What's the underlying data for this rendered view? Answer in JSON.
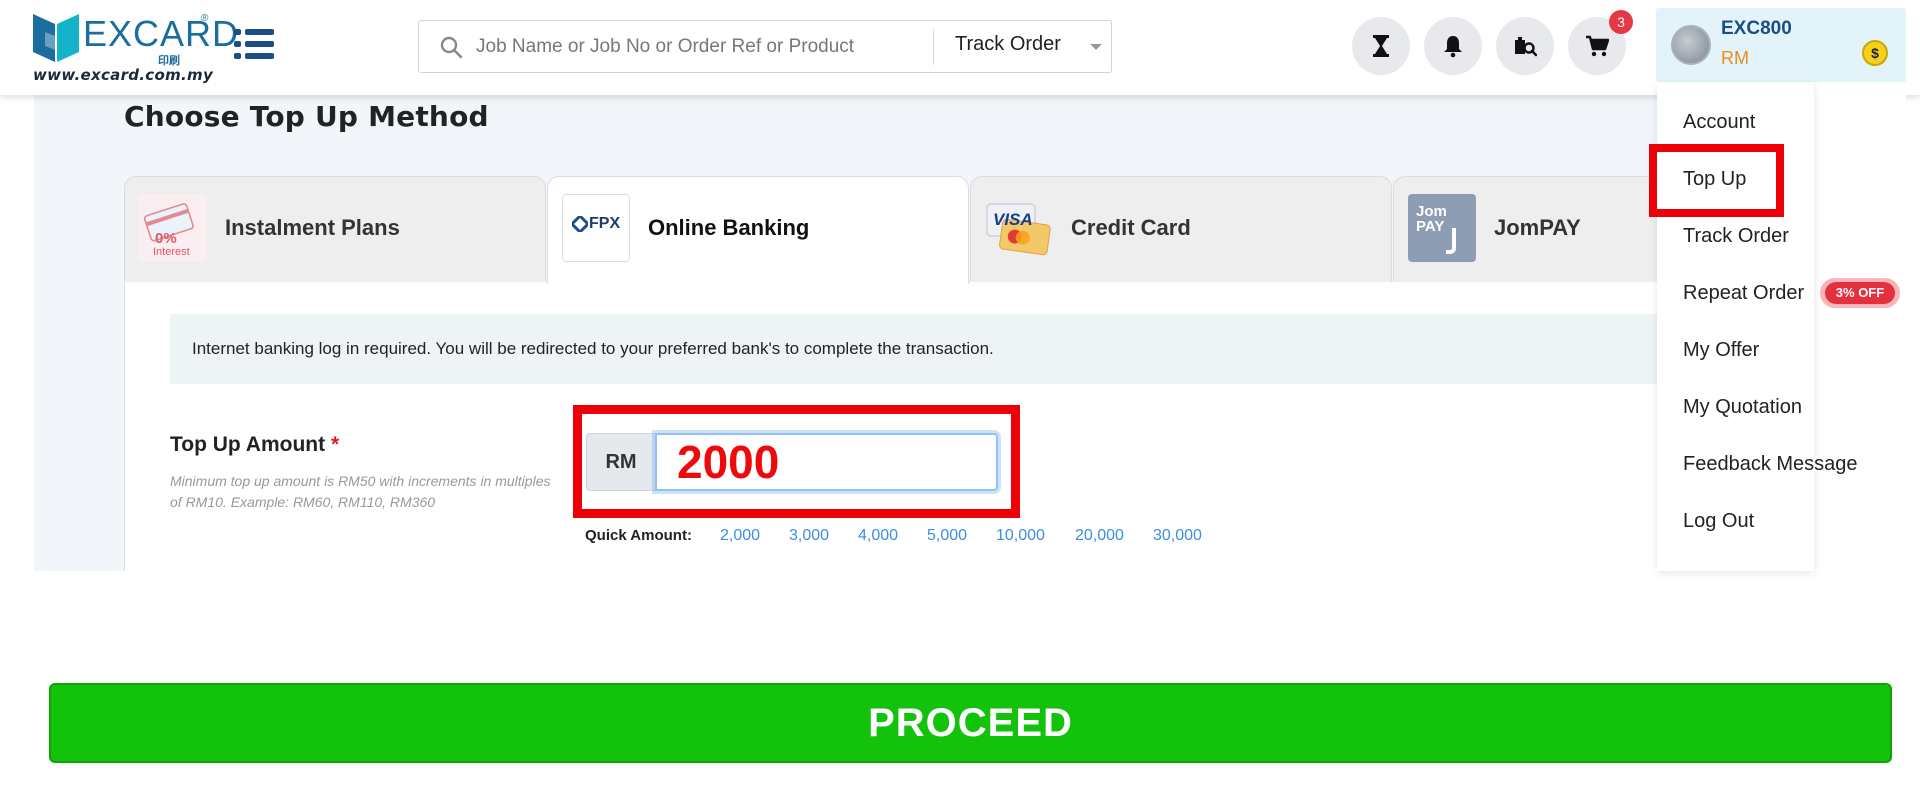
{
  "header": {
    "logo": {
      "word": "EXCARD",
      "reg": "®",
      "sub": "印刷",
      "url": "www.excard.com.my"
    },
    "search": {
      "placeholder": "Job Name or Job No or Order Ref or Product",
      "select_value": "Track Order"
    },
    "icons": [
      "hourglass-icon",
      "bell-icon",
      "job-search-icon",
      "cart-icon"
    ],
    "cart_count": "3",
    "user": {
      "name": "EXC800",
      "balance": "RM",
      "coin_symbol": "$"
    }
  },
  "main": {
    "heading": "Choose Top Up Method",
    "tabs": [
      {
        "label": "Instalment Plans",
        "icon": "instalment-card-icon",
        "icon_text": "0%",
        "icon_sub": "Interest"
      },
      {
        "label": "Online Banking",
        "icon": "fpx-icon",
        "icon_text": "FPX",
        "active": true
      },
      {
        "label": "Credit Card",
        "icon": "visa-card-icon",
        "icon_text": "VISA"
      },
      {
        "label": "JomPAY",
        "icon": "jompay-icon",
        "icon_text": "Jom PAY"
      }
    ],
    "info_text": "Internet banking log in required. You will be redirected to your preferred bank's to complete the transaction.",
    "amount": {
      "label": "Top Up Amount",
      "required_mark": "*",
      "hint": "Minimum top up amount is RM50 with increments in multiples of RM10. Example: RM60, RM110, RM360",
      "currency": "RM",
      "value": "2000"
    },
    "quick": {
      "label": "Quick Amount:",
      "amounts": [
        "2,000",
        "3,000",
        "4,000",
        "5,000",
        "10,000",
        "20,000",
        "30,000"
      ]
    }
  },
  "dropdown": {
    "items": [
      "Account",
      "Top Up",
      "Track Order",
      "Repeat Order",
      "My Offer",
      "My Quotation",
      "Feedback Message",
      "Log Out"
    ],
    "repeat_badge": "3% OFF"
  },
  "proceed_label": "PROCEED",
  "colors": {
    "brand": "#1c4e86",
    "highlight": "#ee0008",
    "proceed": "#13c20a",
    "link": "#3a8ee6"
  }
}
